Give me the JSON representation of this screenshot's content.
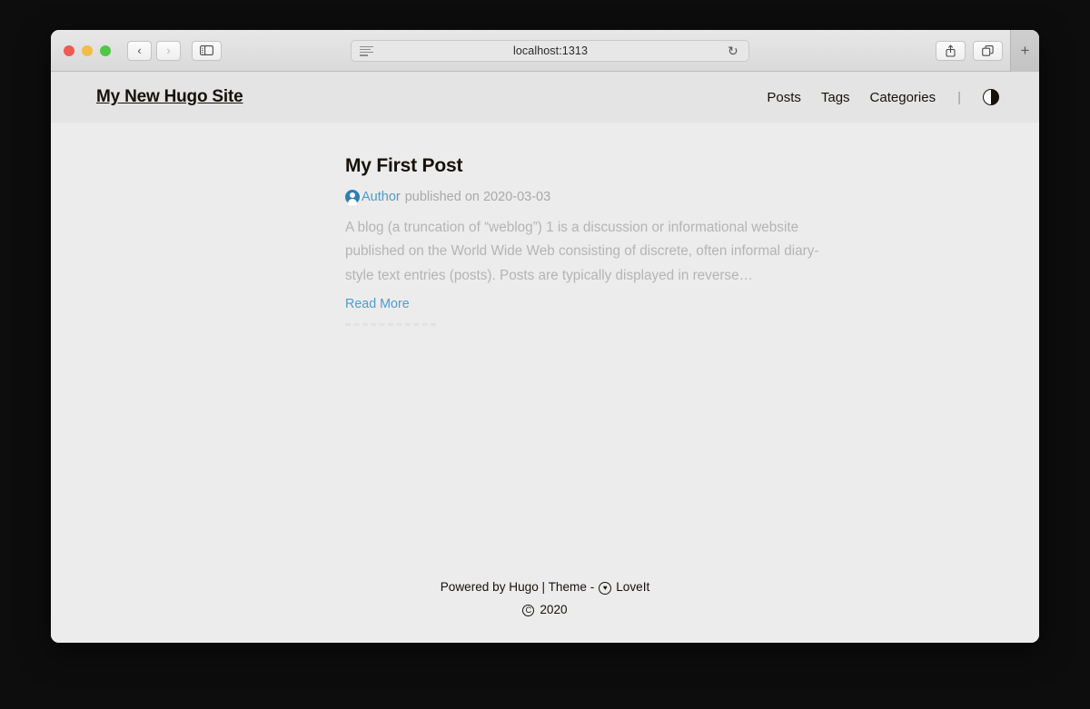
{
  "browser": {
    "window_controls": {
      "close": "close-button",
      "minimize": "minimize-button",
      "maximize": "maximize-button"
    },
    "back_label": "‹",
    "forward_label": "›",
    "sidebar_label": "▥",
    "address": {
      "url": "localhost:1313",
      "reader_icon": "reader-view-icon",
      "reload_icon": "↻"
    },
    "share_label": "↑",
    "tabs_label": "⧉",
    "new_tab_label": "+"
  },
  "site": {
    "title": "My New Hugo Site",
    "nav": [
      {
        "label": "Posts"
      },
      {
        "label": "Tags"
      },
      {
        "label": "Categories"
      }
    ],
    "nav_divider": "|",
    "theme_toggle": "theme-switch-icon"
  },
  "post": {
    "title": "My First Post",
    "author": "Author",
    "meta_rest": "published on 2020-03-03",
    "excerpt": "A blog (a truncation of “weblog”) 1 is a discussion or informational website published on the World Wide Web consisting of discrete, often informal diary-style text entries (posts). Posts are typically displayed in reverse…",
    "read_more": "Read More"
  },
  "footer": {
    "powered_by": "Powered by Hugo | Theme -",
    "theme_name": "LoveIt",
    "theme_icon": "loveit-logo-icon",
    "copyright_year": "2020"
  },
  "colors": {
    "accent_link": "#4e9ccb",
    "author_icon": "#2e7eb8",
    "text": "#161209",
    "muted": "#b4b4b4",
    "page_bg": "#ececec",
    "header_bg": "#e4e4e4"
  }
}
